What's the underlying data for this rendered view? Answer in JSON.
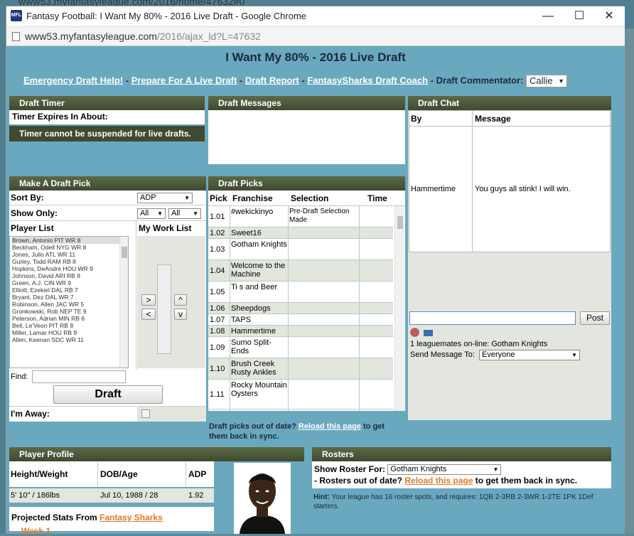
{
  "background": {
    "url_fragment": "www53.myfantasyleague.com/2016/home/47632#0",
    "week_label": "Week 1"
  },
  "window": {
    "title": "Fantasy Football: I Want My 80% - 2016 Live Draft - Google Chrome",
    "logo_text": "MFL",
    "url_host": "www53.myfantasyleague.com",
    "url_path": "/2016/ajax_ld?L=47632",
    "minimize": "—",
    "maximize": "☐",
    "close": "✕"
  },
  "page": {
    "title": "I Want My 80% - 2016 Live Draft",
    "links": [
      "Emergency Draft Help!",
      "Prepare For A Live Draft",
      "Draft Report",
      "FantasySharks Draft Coach"
    ],
    "commentator_label": "- Draft Commentator:",
    "commentator_value": "Callie"
  },
  "timer": {
    "header": "Draft Timer",
    "expires_label": "Timer Expires In About:",
    "notice": "Timer cannot be suspended for live drafts."
  },
  "messages": {
    "header": "Draft Messages"
  },
  "chat": {
    "header": "Draft Chat",
    "col_by": "By",
    "col_message": "Message",
    "entries": [
      {
        "by": "Hammertime",
        "message": "You guys all stink! I will win."
      }
    ],
    "post_button": "Post",
    "online_text": "1 leaguemates on-line: Gotham Knights",
    "send_to_label": "Send Message To:",
    "send_to_value": "Everyone"
  },
  "make_pick": {
    "header": "Make A Draft Pick",
    "sort_by_label": "Sort By:",
    "sort_by_value": "ADP",
    "show_only_label": "Show Only:",
    "show_only_value_1": "All",
    "show_only_value_2": "All",
    "player_list_label": "Player List",
    "work_list_label": "My Work List",
    "players": [
      "Brown, Antonio PIT WR 8",
      "Beckham, Odell NYG WR 8",
      "Jones, Julio ATL WR 11",
      "Gurley, Todd RAM RB 8",
      "Hopkins, DeAndre HOU WR 9",
      "Johnson, David ARI RB 9",
      "Green, A.J. CIN WR 9",
      "Elliott, Ezekiel DAL RB 7",
      "Bryant, Dez DAL WR 7",
      "Robinson, Allen JAC WR 5",
      "Gronkowski, Rob NEP TE 9",
      "Peterson, Adrian MIN RB 6",
      "Bell, Le'Veon PIT RB 8",
      "Miller, Lamar HOU RB 9",
      "Allen, Keenan SDC WR 11"
    ],
    "find_label": "Find:",
    "move_right": ">",
    "move_left": "<",
    "move_up": "^",
    "move_down": "v",
    "draft_button": "Draft",
    "away_label": "I'm Away:"
  },
  "picks": {
    "header": "Draft Picks",
    "col_pick": "Pick",
    "col_franchise": "Franchise",
    "col_selection": "Selection",
    "col_time": "Time",
    "rows": [
      {
        "pick": "1.01",
        "franchise": "#wekickinyo",
        "selection": "Pre-Draft Selection Made"
      },
      {
        "pick": "1.02",
        "franchise": "Sweet16",
        "selection": ""
      },
      {
        "pick": "1.03",
        "franchise": "Gotham Knights",
        "selection": ""
      },
      {
        "pick": "1.04",
        "franchise": "Welcome to the Machine",
        "selection": ""
      },
      {
        "pick": "1.05",
        "franchise": "Ti   s and Beer",
        "selection": ""
      },
      {
        "pick": "1.06",
        "franchise": "Sheepdogs",
        "selection": ""
      },
      {
        "pick": "1.07",
        "franchise": "TAPS",
        "selection": ""
      },
      {
        "pick": "1.08",
        "franchise": "Hammertime",
        "selection": ""
      },
      {
        "pick": "1.09",
        "franchise": "Sumo Split-Ends",
        "selection": ""
      },
      {
        "pick": "1.10",
        "franchise": "Brush Creek Rusty Ankles",
        "selection": ""
      },
      {
        "pick": "1.11",
        "franchise": "Rocky Mountain Oysters",
        "selection": ""
      }
    ],
    "reload_prefix": "Draft picks out of date?",
    "reload_link": "Reload this page",
    "reload_suffix": "to get them back in sync."
  },
  "profile": {
    "header": "Player Profile",
    "col_hw": "Height/Weight",
    "col_dob": "DOB/Age",
    "col_adp": "ADP",
    "hw": "5' 10\" / 186lbs",
    "dob": "Jul 10, 1988 / 28",
    "adp": "1.92",
    "proj_label": "Projected Stats From",
    "proj_link": "Fantasy Sharks"
  },
  "rosters": {
    "header": "Rosters",
    "show_label": "Show Roster For:",
    "show_value": "Gotham Knights",
    "out_of_date": "- Rosters out of date?",
    "reload_link": "Reload this page",
    "reload_suffix": "to get them back in sync.",
    "hint_label": "Hint:",
    "hint": "Your league has 16 roster spots, and requires: 1QB 2-3RB 2-3WR 1-2TE 1PK 1Def starters."
  }
}
